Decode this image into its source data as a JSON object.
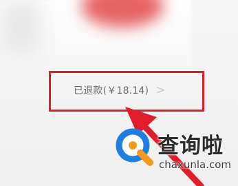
{
  "refund": {
    "label": "已退款(￥18.14)",
    "chevron": ">"
  },
  "watermark": {
    "brand_cn": "查询啦",
    "url": "chaxunla.com",
    "logo_icon": "search-q-icon"
  },
  "colors": {
    "highlight": "#e11d2a",
    "logo_blue": "#1e7fe0",
    "logo_orange": "#f59a1b"
  }
}
